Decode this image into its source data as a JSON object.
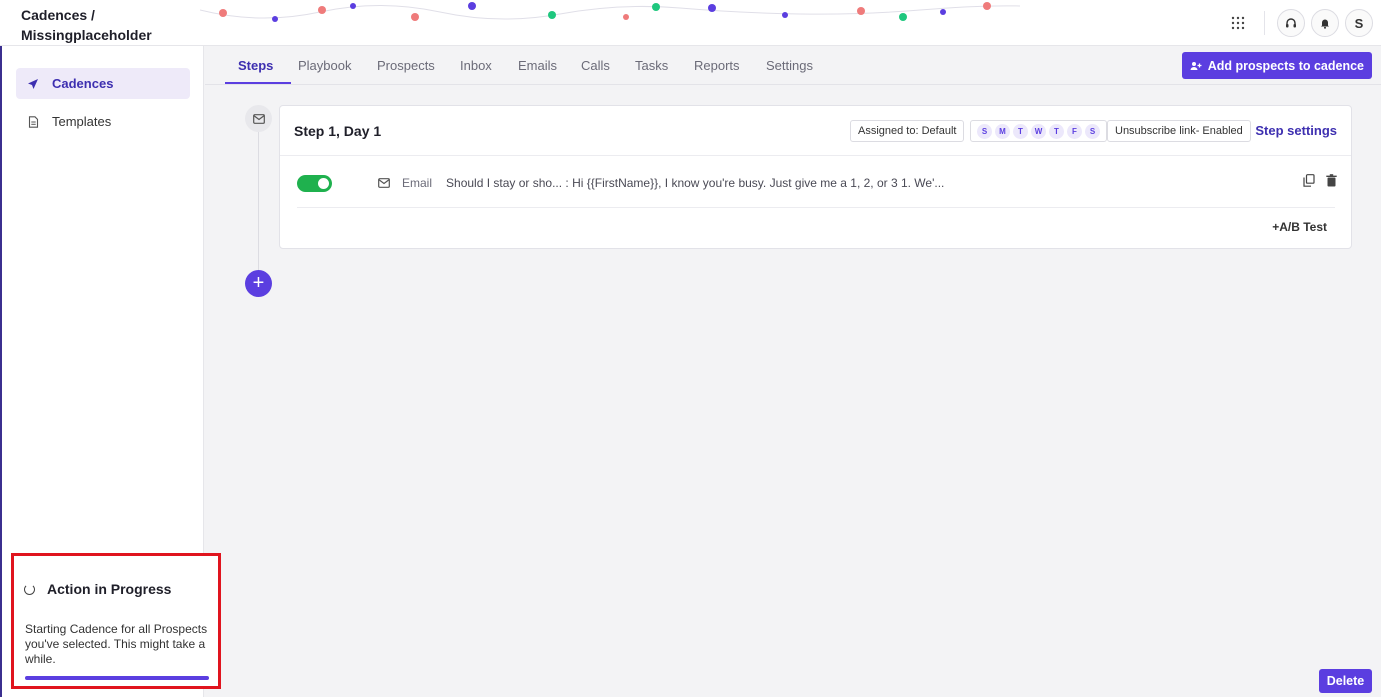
{
  "header": {
    "breadcrumb_line1": "Cadences /",
    "breadcrumb_line2": "Missingplaceholder",
    "avatar_initial": "S",
    "icons": [
      "apps-grid-icon",
      "headset-icon",
      "bell-icon"
    ]
  },
  "sidebar": {
    "items": [
      {
        "label": "Cadences",
        "icon": "send-icon",
        "active": true
      },
      {
        "label": "Templates",
        "icon": "document-icon",
        "active": false
      }
    ]
  },
  "progress": {
    "title": "Action in Progress",
    "message": "Starting Cadence for all Prospects you've selected. This might take a while.",
    "fraction": 1.0,
    "bar_color": "#5b3ee0"
  },
  "tabs": {
    "items": [
      "Steps",
      "Playbook",
      "Prospects",
      "Inbox",
      "Emails",
      "Calls",
      "Tasks",
      "Reports",
      "Settings"
    ],
    "active": "Steps",
    "add_button": "Add prospects to cadence"
  },
  "step": {
    "title": "Step 1, Day 1",
    "assigned": "Assigned to: Default",
    "days": [
      "S",
      "M",
      "T",
      "W",
      "T",
      "F",
      "S"
    ],
    "unsubscribe": "Unsubscribe link- Enabled",
    "settings_link": "Step settings",
    "email": {
      "enabled": true,
      "type": "Email",
      "preview": "Should I stay or sho... : Hi {{FirstName}}, I know you're busy. Just give me a 1, 2, or 3 1. We'..."
    },
    "ab_test": "+A/B Test"
  },
  "footer": {
    "delete_label": "Delete"
  },
  "colors": {
    "accent": "#5b3ee0",
    "toggle_on": "#1fb14e",
    "highlight_border": "#e0141e"
  }
}
